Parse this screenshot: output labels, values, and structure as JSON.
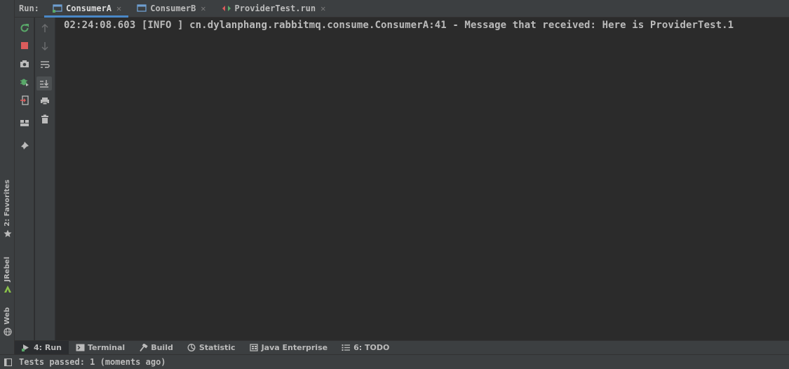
{
  "run_panel": {
    "label": "Run:",
    "tabs": [
      {
        "label": "ConsumerA",
        "active": true
      },
      {
        "label": "ConsumerB",
        "active": false
      },
      {
        "label": "ProviderTest.run",
        "active": false
      }
    ]
  },
  "console": {
    "lines": [
      "02:24:08.603 [INFO ] cn.dylanphang.rabbitmq.consume.ConsumerA:41 - Message that received: Here is ProviderTest.1"
    ]
  },
  "left_strip": {
    "favorites": "2: Favorites",
    "jrebel": "JRebel",
    "web": "Web"
  },
  "bottom_tabs": [
    {
      "label": "4: Run",
      "icon": "run-icon",
      "active": true
    },
    {
      "label": "Terminal",
      "icon": "terminal-icon",
      "active": false
    },
    {
      "label": "Build",
      "icon": "hammer-icon",
      "active": false
    },
    {
      "label": "Statistic",
      "icon": "statistic-icon",
      "active": false
    },
    {
      "label": "Java Enterprise",
      "icon": "java-enterprise-icon",
      "active": false
    },
    {
      "label": "6: TODO",
      "icon": "todo-list-icon",
      "active": false
    }
  ],
  "status": {
    "text": "Tests passed: 1 (moments ago)"
  },
  "colors": {
    "accent": "#4a88c7",
    "rerun_green": "#59a869",
    "stop_red": "#db5c5c",
    "background": "#2b2b2b",
    "panel": "#3c3f41"
  }
}
